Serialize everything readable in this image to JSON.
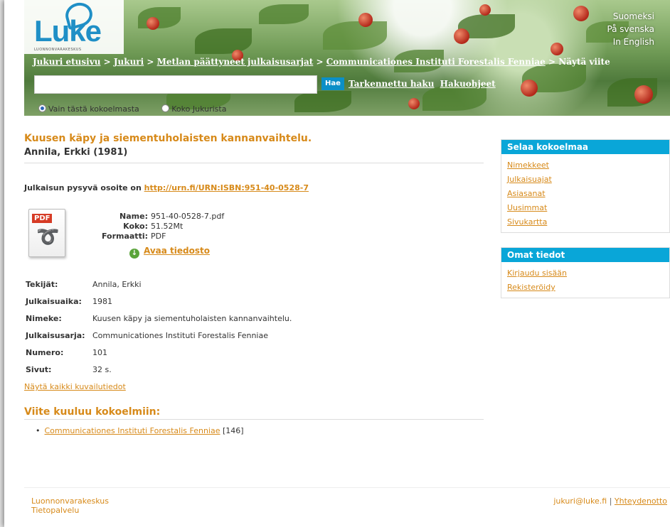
{
  "header": {
    "logo_text": "Luke",
    "logo_subtitle": "LUONNONVARAKESKUS",
    "languages": [
      "Suomeksi",
      "På svenska",
      "In English"
    ],
    "breadcrumb": {
      "items": [
        "Jukuri etusivu",
        "Jukuri",
        "Metlan päättyneet julkaisusarjat",
        "Communicationes Instituti Forestalis Fenniae"
      ],
      "separator": ">",
      "current": "Näytä viite"
    },
    "search": {
      "value": "",
      "button": "Hae",
      "advanced": "Tarkennettu haku",
      "help": "Hakuohjeet",
      "scope_this": "Vain tästä kokoelmasta",
      "scope_all": "Koko Jukurista"
    }
  },
  "item": {
    "title": "Kuusen käpy ja siementuholaisten kannanvaihtelu.",
    "author_line": "Annila, Erkki (1981)",
    "permalink_label": "Julkaisun pysyvä osoite on",
    "permalink_url": "http://urn.fi/URN:ISBN:951-40-0528-7",
    "file": {
      "icon_label": "PDF",
      "name_label": "Name:",
      "name": "951-40-0528-7.pdf",
      "size_label": "Koko:",
      "size": "51.52Mt",
      "format_label": "Formaatti:",
      "format": "PDF",
      "open_label": "Avaa tiedosto"
    },
    "fields": [
      {
        "label": "Tekijät:",
        "value": "Annila, Erkki"
      },
      {
        "label": "Julkaisuaika:",
        "value": "1981"
      },
      {
        "label": "Nimeke:",
        "value": "Kuusen käpy ja siementuholaisten kannanvaihtelu."
      },
      {
        "label": "Julkaisusarja:",
        "value": "Communicationes Instituti Forestalis Fenniae"
      },
      {
        "label": "Numero:",
        "value": "101"
      },
      {
        "label": "Sivut:",
        "value": "32 s."
      }
    ],
    "show_all": "Näytä kaikki kuvailutiedot",
    "collections_heading": "Viite kuuluu kokoelmiin:",
    "collection": {
      "name": "Communicationes Instituti Forestalis Fenniae",
      "count": "[146]"
    }
  },
  "sidebar": {
    "browse": {
      "heading": "Selaa kokoelmaa",
      "links": [
        "Nimekkeet",
        "Julkaisuajat",
        "Asiasanat",
        "Uusimmat",
        "Sivukartta"
      ]
    },
    "account": {
      "heading": "Omat tiedot",
      "links": [
        "Kirjaudu sisään",
        "Rekisteröidy"
      ]
    }
  },
  "footer": {
    "org": "Luonnonvarakeskus",
    "unit": "Tietopalvelu",
    "email": "jukuri@luke.fi",
    "separator": "|",
    "contact": "Yhteydenotto"
  },
  "colors": {
    "accent": "#d78a1a",
    "header_blue": "#09a6d8",
    "logo_blue": "#1f8fc6"
  }
}
